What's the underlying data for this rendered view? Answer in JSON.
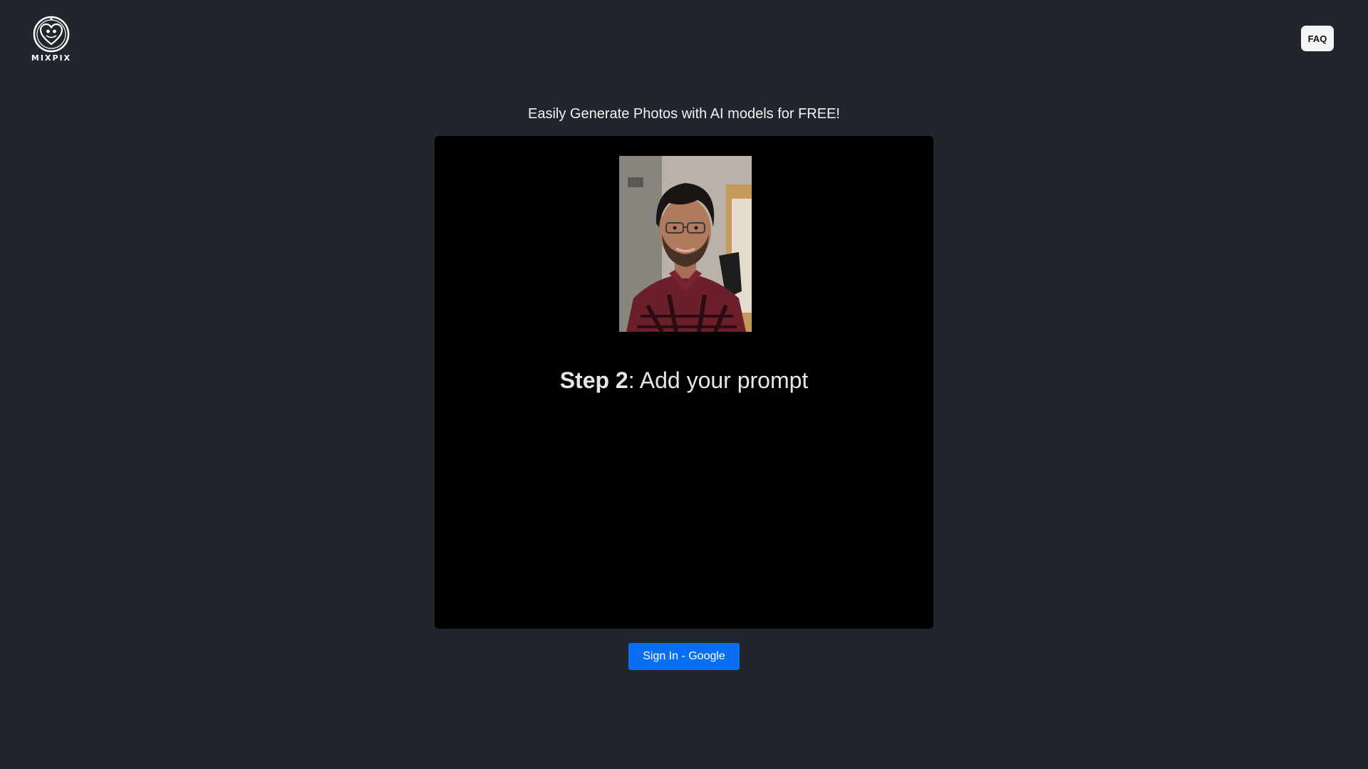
{
  "header": {
    "logo_text": "MIXPIX",
    "logo_icon": "heart-badge-icon",
    "faq_label": "FAQ"
  },
  "main": {
    "headline": "Easily Generate Photos with AI models for FREE!",
    "video": {
      "step_label": "Step 2",
      "step_text": ": Add your prompt",
      "photo_alt": "person-photo"
    },
    "signin_label": "Sign In - Google"
  },
  "colors": {
    "background": "#23252e",
    "accent": "#0a6ef5",
    "video_background": "#000000"
  }
}
